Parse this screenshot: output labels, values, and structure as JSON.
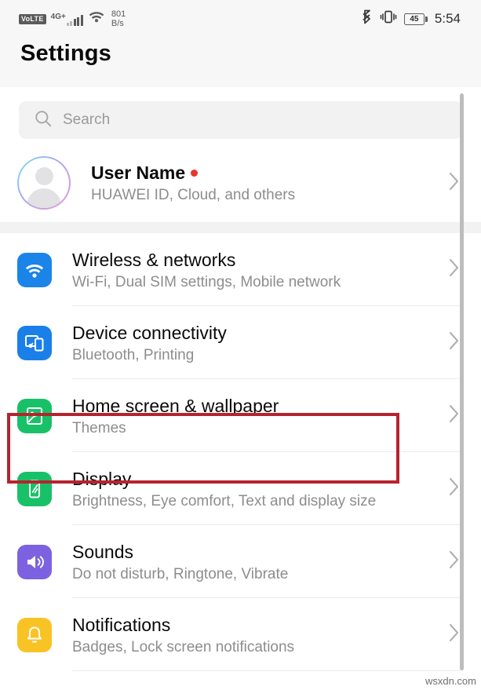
{
  "status_bar": {
    "volte_label": "VoLTE",
    "network_type": "4G+",
    "signal_bars": 5,
    "signal_bars_active": 3,
    "wifi_icon": "wifi-icon",
    "data_speed_value": "801",
    "data_speed_unit": "B/s",
    "bluetooth_icon": "bluetooth-icon",
    "vibrate_icon": "vibrate-icon",
    "battery_percent": "45",
    "time": "5:54"
  },
  "header": {
    "title": "Settings"
  },
  "search": {
    "icon": "search-icon",
    "placeholder": "Search",
    "value": ""
  },
  "profile": {
    "avatar_icon": "person-avatar-icon",
    "name": "User Name",
    "has_notification_dot": true,
    "subtitle": "HUAWEI ID, Cloud, and others",
    "chevron_icon": "chevron-right-icon"
  },
  "settings_list": [
    {
      "id": "wireless-networks",
      "title": "Wireless & networks",
      "subtitle": "Wi-Fi, Dual SIM settings, Mobile network",
      "icon": "wifi-icon",
      "icon_color": "#1a84e8"
    },
    {
      "id": "device-connectivity",
      "title": "Device connectivity",
      "subtitle": "Bluetooth, Printing",
      "icon": "device-connectivity-icon",
      "icon_color": "#1a7fe8",
      "highlighted": true
    },
    {
      "id": "home-screen-wallpaper",
      "title": "Home screen & wallpaper",
      "subtitle": "Themes",
      "icon": "image-icon",
      "icon_color": "#18c168"
    },
    {
      "id": "display",
      "title": "Display",
      "subtitle": "Brightness, Eye comfort, Text and display size",
      "icon": "phone-screen-icon",
      "icon_color": "#18c168"
    },
    {
      "id": "sounds",
      "title": "Sounds",
      "subtitle": "Do not disturb, Ringtone, Vibrate",
      "icon": "speaker-icon",
      "icon_color": "#7c62e0"
    },
    {
      "id": "notifications",
      "title": "Notifications",
      "subtitle": "Badges, Lock screen notifications",
      "icon": "bell-icon",
      "icon_color": "#f9c325"
    }
  ],
  "highlight": {
    "target_row_id": "device-connectivity",
    "color": "#b5242e"
  },
  "scrollbar": {
    "icon": "scrollbar-thumb"
  },
  "watermark": {
    "text": "wsxdn.com"
  }
}
